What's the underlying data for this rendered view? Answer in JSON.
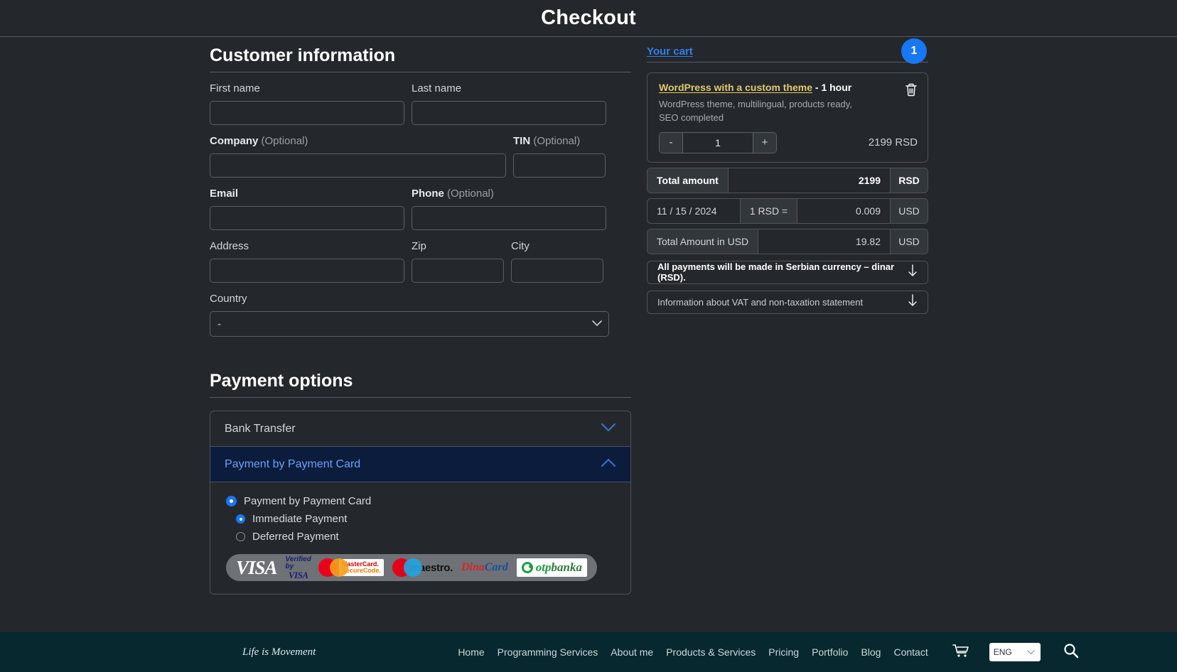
{
  "header": {
    "title": "Checkout"
  },
  "customer": {
    "section_title": "Customer information",
    "fields": {
      "first_name": {
        "label": "First name",
        "value": ""
      },
      "last_name": {
        "label": "Last name",
        "value": ""
      },
      "company": {
        "label": "Company",
        "optional": "(Optional)",
        "value": ""
      },
      "tin": {
        "label": "TIN",
        "optional": "(Optional)",
        "value": ""
      },
      "email": {
        "label": "Email",
        "value": ""
      },
      "phone": {
        "label": "Phone",
        "optional": "(Optional)",
        "value": ""
      },
      "address": {
        "label": "Address",
        "value": ""
      },
      "zip": {
        "label": "Zip",
        "value": ""
      },
      "city": {
        "label": "City",
        "value": ""
      },
      "country": {
        "label": "Country",
        "selected": "-"
      }
    }
  },
  "payment": {
    "section_title": "Payment options",
    "methods": [
      {
        "label": "Bank Transfer",
        "expanded": false,
        "chevron": "chevron-down-icon"
      },
      {
        "label": "Payment by Payment Card",
        "expanded": true,
        "chevron": "chevron-up-icon"
      }
    ],
    "options": [
      {
        "label": "Payment by Payment Card",
        "selected": true,
        "indent": false
      },
      {
        "label": "Immediate Payment",
        "selected": true,
        "indent": true
      },
      {
        "label": "Deferred Payment",
        "selected": false,
        "indent": true
      }
    ],
    "logos": [
      "visa-logo",
      "verified-by-visa-logo",
      "mastercard-logo",
      "mastercard-securecode-logo",
      "maestro-logo",
      "dinacard-logo",
      "otp-banka-logo"
    ],
    "logo_text": {
      "visa": "VISA",
      "verified_line1": "Verified by",
      "verified_line2": "VISA",
      "securecode_line1": "MasterCard.",
      "securecode_line2": "SecureCode.",
      "maestro": "maestro.",
      "dina_part1": "Dina",
      "dina_part2": "Card",
      "otp_part1": "otp",
      "otp_part2": "banka"
    }
  },
  "cart": {
    "title": "Your cart",
    "badge_count": "1",
    "item": {
      "name": "WordPress with a custom theme",
      "duration": "- 1 hour",
      "description": "WordPress theme, multilingual, products ready, SEO completed",
      "quantity": "1",
      "price": "2199 RSD",
      "minus_label": "-",
      "plus_label": "+",
      "delete_icon": "trash-icon"
    },
    "summary": {
      "total_label": "Total amount",
      "total_value": "2199",
      "total_currency": "RSD",
      "rate_date": "11 / 15 / 2024",
      "rate_label": "1 RSD =",
      "rate_value": "0.009",
      "rate_currency": "USD",
      "usd_label": "Total Amount in USD",
      "usd_value": "19.82",
      "usd_currency": "USD"
    },
    "notices": [
      {
        "text": "All payments will be made in Serbian currency – dinar (RSD).",
        "bold": true,
        "icon": "arrow-down-icon"
      },
      {
        "text": "Information about VAT and non-taxation statement",
        "bold": false,
        "icon": "arrow-down-icon"
      }
    ]
  },
  "footer": {
    "brand": "Life is Movement",
    "nav": [
      "Home",
      "Programming Services",
      "About me",
      "Products & Services",
      "Pricing",
      "Portfolio",
      "Blog",
      "Contact"
    ],
    "cart_icon": "shopping-cart-icon",
    "language": "ENG",
    "search_icon": "search-icon"
  },
  "colors": {
    "background": "#24282c",
    "accent_blue": "#1877f2",
    "link_gold": "#e3c96a",
    "footer_bg": "#06282e",
    "active_method_bg": "#0b1c3d"
  }
}
